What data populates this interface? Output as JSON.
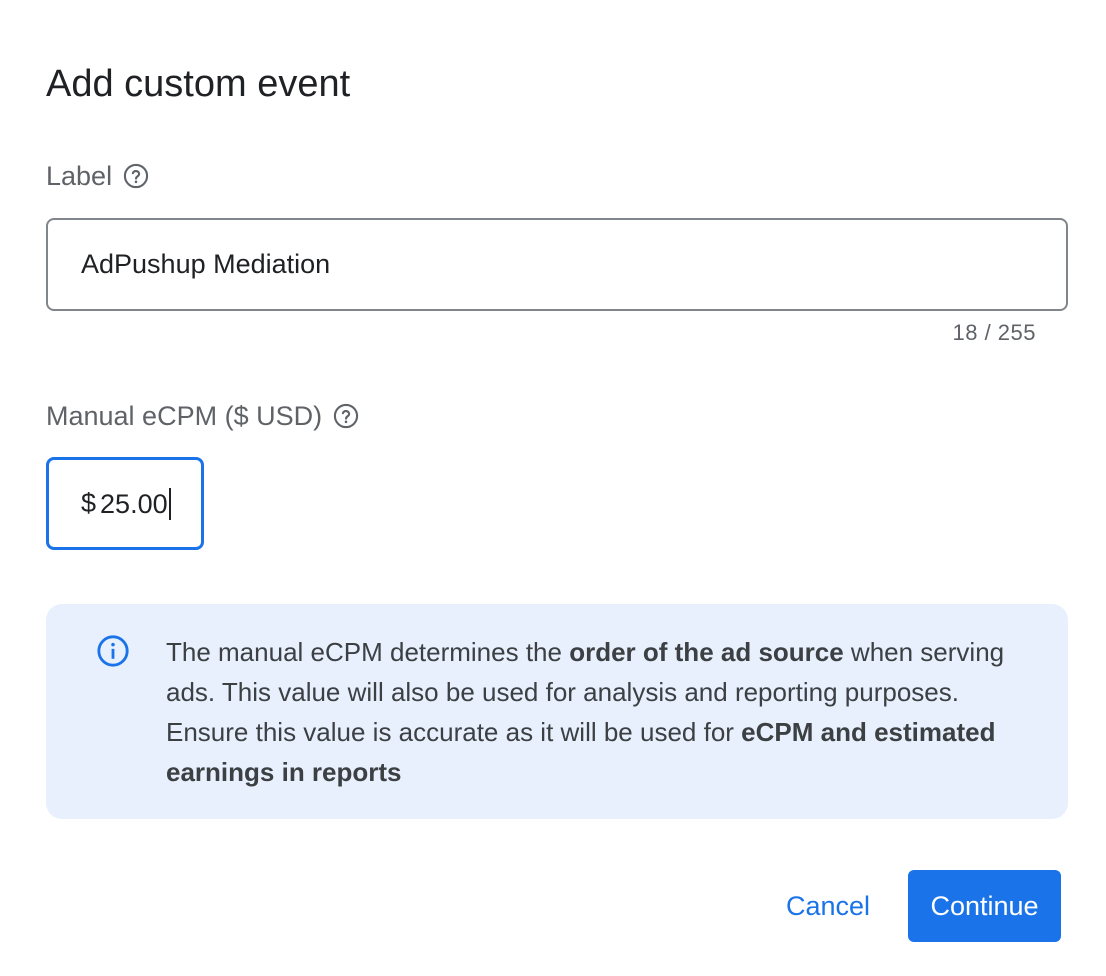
{
  "dialog": {
    "title": "Add custom event"
  },
  "label_field": {
    "label": "Label",
    "help_icon": "help-circle-icon",
    "value": "AdPushup Mediation",
    "char_count": "18 / 255"
  },
  "ecpm_field": {
    "label": "Manual eCPM ($ USD)",
    "help_icon": "help-circle-icon",
    "currency_symbol": "$",
    "value": "25.00"
  },
  "info_box": {
    "icon": "info-icon",
    "text_part1": "The manual eCPM determines the ",
    "text_bold1": "order of the ad source",
    "text_part2": " when serving ads. This value will also be used for analysis and reporting purposes. Ensure this value is accurate as it will be used for ",
    "text_bold2": "eCPM and estimated earnings in reports",
    "background_color": "#e8f0fe"
  },
  "actions": {
    "cancel_label": "Cancel",
    "continue_label": "Continue",
    "accent_color": "#1a73e8"
  }
}
